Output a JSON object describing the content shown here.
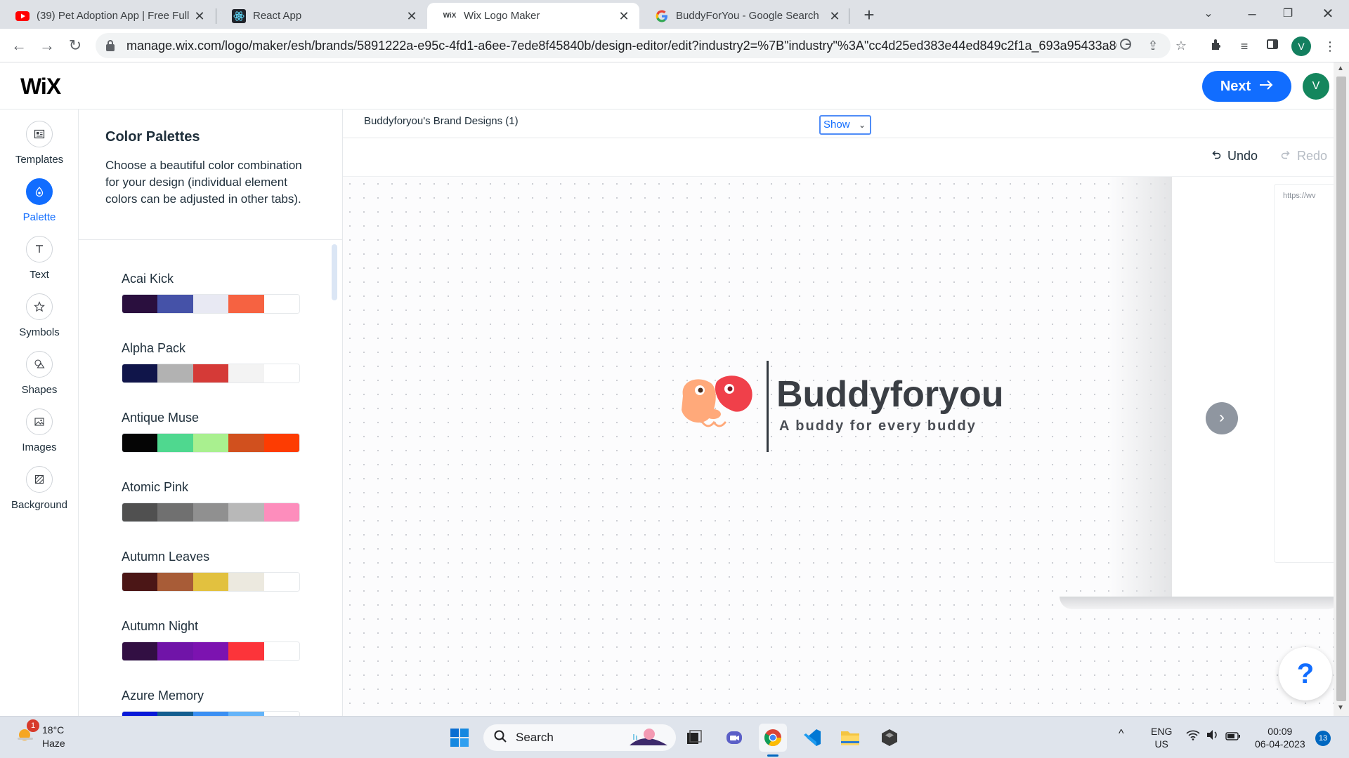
{
  "browser": {
    "tabs": [
      {
        "title": "(39) Pet Adoption App | Free Full",
        "favicon": "youtube-icon"
      },
      {
        "title": "React App",
        "favicon": "react-icon"
      },
      {
        "title": "Wix Logo Maker",
        "favicon": "wix-icon",
        "favicon_text": "WiX"
      },
      {
        "title": "BuddyForYou - Google Search",
        "favicon": "google-icon"
      }
    ],
    "url": "manage.wix.com/logo/maker/esh/brands/5891222a-e95c-4fd1-a6ee-7ede8f45840b/design-editor/edit?industry2=%7B\"industry\"%3A\"cc4d25ed383e44ed849c2f1a_693a95433a86e...",
    "profile_initial": "V"
  },
  "wix": {
    "logo": "WiX",
    "next_label": "Next",
    "avatar_initial": "V",
    "accent": "#116dff"
  },
  "rail": [
    {
      "label": "Templates",
      "icon": "templates-icon"
    },
    {
      "label": "Palette",
      "icon": "palette-icon",
      "active": true
    },
    {
      "label": "Text",
      "icon": "text-icon"
    },
    {
      "label": "Symbols",
      "icon": "star-icon"
    },
    {
      "label": "Shapes",
      "icon": "shapes-icon"
    },
    {
      "label": "Images",
      "icon": "image-icon"
    },
    {
      "label": "Background",
      "icon": "background-icon"
    }
  ],
  "panel": {
    "title": "Color Palettes",
    "description": "Choose a beautiful color combination for your design (individual element colors can be adjusted in other tabs).",
    "palettes": [
      {
        "name": "Acai Kick",
        "colors": [
          "#2a0f3e",
          "#4552a8",
          "#e8e9f3",
          "#f66241",
          "#ffffff"
        ]
      },
      {
        "name": "Alpha Pack",
        "colors": [
          "#10154a",
          "#b2b2b2",
          "#d53a37",
          "#f3f3f3",
          "#ffffff"
        ]
      },
      {
        "name": "Antique Muse",
        "colors": [
          "#050505",
          "#4fd88f",
          "#a9f08f",
          "#d1501e",
          "#fd3c02"
        ]
      },
      {
        "name": "Atomic Pink",
        "colors": [
          "#505050",
          "#707070",
          "#909090",
          "#b8b8b8",
          "#fd8dbc"
        ]
      },
      {
        "name": "Autumn Leaves",
        "colors": [
          "#4b1616",
          "#a85c37",
          "#e2c13f",
          "#ece9df",
          "#ffffff"
        ]
      },
      {
        "name": "Autumn Night",
        "colors": [
          "#320f43",
          "#7014a8",
          "#7c13b0",
          "#fc343a",
          "#ffffff"
        ]
      },
      {
        "name": "Azure Memory",
        "colors": [
          "#0819d8",
          "#135d8f",
          "#3a8ff3",
          "#64b4f9",
          "#ffffff"
        ]
      }
    ]
  },
  "editor": {
    "brand_designs": "Buddyforyou's Brand Designs (1)",
    "show_label": "Show",
    "undo_label": "Undo",
    "redo_label": "Redo",
    "mini_url": "https://wv"
  },
  "logo": {
    "name": "Buddyforyou",
    "tagline": "A buddy for every buddy",
    "colors": {
      "peach": "#ffa97a",
      "red": "#f0404a",
      "text": "#3a3e44"
    }
  },
  "help_label": "?",
  "taskbar": {
    "weather_temp": "18°C",
    "weather_desc": "Haze",
    "weather_badge": "1",
    "search_label": "Search",
    "lang_top": "ENG",
    "lang_bottom": "US",
    "time": "00:09",
    "date": "06-04-2023",
    "notif_count": "13"
  }
}
